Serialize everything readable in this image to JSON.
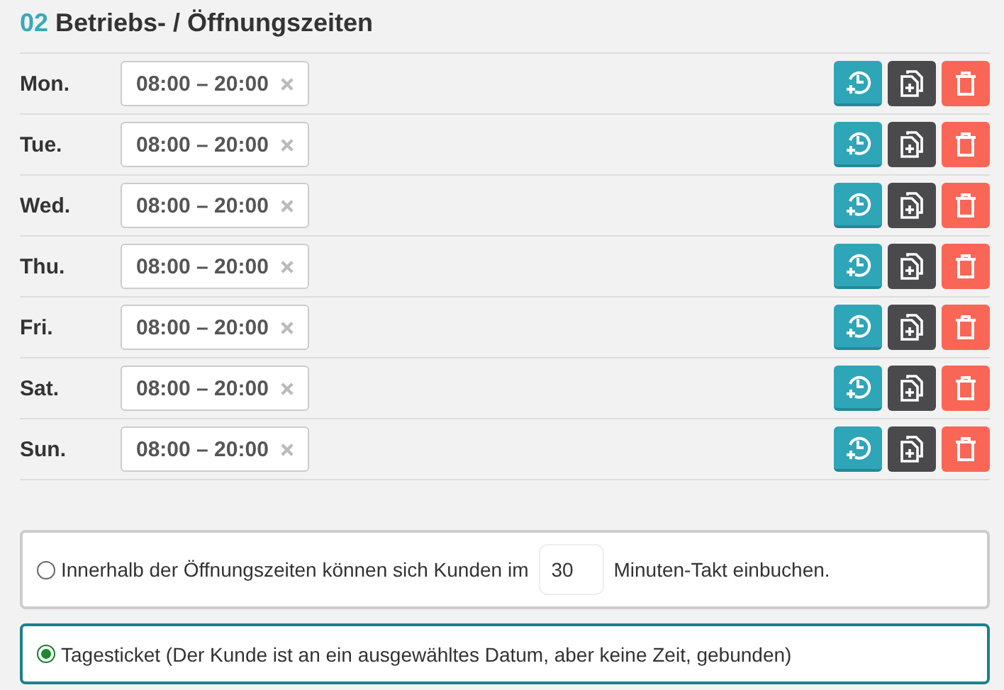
{
  "section": {
    "number": "02",
    "title": "Betriebs- / Öffnungszeiten"
  },
  "days": [
    {
      "label": "Mon.",
      "slots": [
        "08:00 – 20:00"
      ]
    },
    {
      "label": "Tue.",
      "slots": [
        "08:00 – 20:00"
      ]
    },
    {
      "label": "Wed.",
      "slots": [
        "08:00 – 20:00"
      ]
    },
    {
      "label": "Thu.",
      "slots": [
        "08:00 – 20:00"
      ]
    },
    {
      "label": "Fri.",
      "slots": [
        "08:00 – 20:00"
      ]
    },
    {
      "label": "Sat.",
      "slots": [
        "08:00 – 20:00"
      ]
    },
    {
      "label": "Sun.",
      "slots": [
        "08:00 – 20:00"
      ]
    }
  ],
  "options": [
    {
      "kind": "interval",
      "selected": false,
      "text_before": "Innerhalb der Öffnungszeiten können sich Kunden im",
      "value": "30",
      "text_after": "Minuten-Takt einbuchen."
    },
    {
      "kind": "plain",
      "selected": true,
      "text": "Tagesticket (Der Kunde ist an ein ausgewähltes Datum, aber keine Zeit, gebunden)"
    }
  ]
}
